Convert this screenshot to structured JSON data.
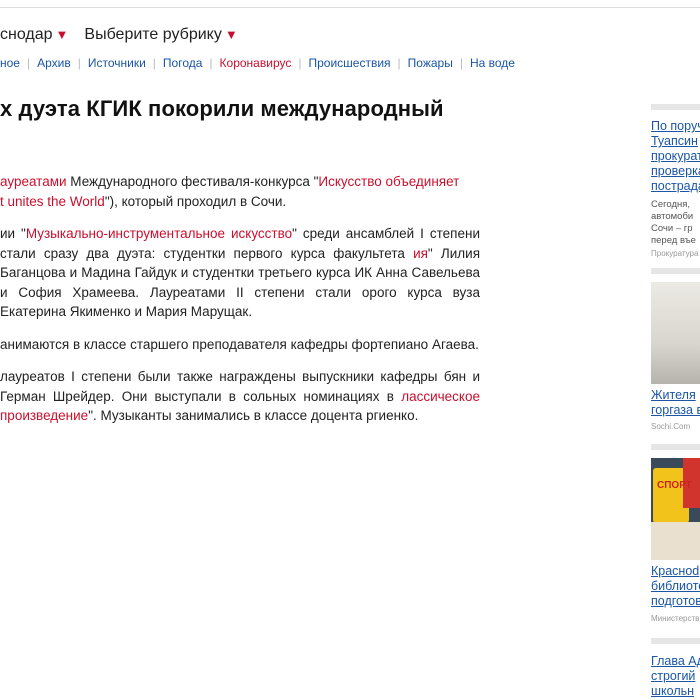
{
  "header": {
    "region": "снодар",
    "rubric": "Выберите рубрику"
  },
  "subnav": [
    {
      "label": "ное",
      "accent": false
    },
    {
      "label": "Архив",
      "accent": false
    },
    {
      "label": "Источники",
      "accent": false
    },
    {
      "label": "Погода",
      "accent": false
    },
    {
      "label": "Коронавирус",
      "accent": true
    },
    {
      "label": "Происшествия",
      "accent": false
    },
    {
      "label": "Пожары",
      "accent": false
    },
    {
      "label": "На воде",
      "accent": false
    }
  ],
  "article": {
    "title": "х дуэта КГИК покорили международный",
    "p1": {
      "link1": "ауреатами",
      "t1": " Международного фестиваля-конкурса \"",
      "link2": "Искусство объединяет",
      "link3": "t unites the World",
      "t2": "\"), который проходил в Сочи."
    },
    "p2": {
      "t1": "ии \"",
      "link1": "Музыкально-инструментальное искусство",
      "t2": "\" среди ансамблей",
      "t3": "I степени стали сразу два дуэта: студентки первого курса факультета",
      "link2": "ия",
      "t4": "\" Лилия Баганцова и Мадина Гайдук и студентки третьего курса",
      "t5": "ИК Анна Савельева и София Храмеева. Лауреатами II степени стали",
      "t6": "орого курса вуза Екатерина Якименко и Мария Марущак."
    },
    "p3": {
      "t1": "анимаются в классе старшего преподавателя кафедры фортепиано",
      "t2": "Агаева."
    },
    "p4": {
      "t1": "лауреатов I степени были также награждены выпускники кафедры",
      "t2": "бян и Герман Шрейдер. Они выступали в сольных номинациях в",
      "link1": "лассическое произведение",
      "t3": "\". Музыканты занимались в классе доцента",
      "t4": "ргиенко."
    }
  },
  "sidebar": {
    "card1": {
      "lines": [
        "По поруч",
        "Туапсин",
        "прокурат",
        "проверка",
        "пострада"
      ],
      "snippet": [
        "Сегодня,",
        "автомоби",
        "Сочи – гр",
        "перед въе"
      ],
      "source": "Прокуратура"
    },
    "card2": {
      "lines": [
        "Жителя",
        "горгаза в"
      ],
      "source": "Sochi.Com"
    },
    "card3": {
      "image_text": "СПОРТ",
      "lines": [
        "Красноd",
        "библиото",
        "подготов"
      ],
      "source": "Министерств"
    },
    "card4": {
      "lines": [
        "Глава Ад",
        "строгий",
        "школьн"
      ]
    }
  }
}
